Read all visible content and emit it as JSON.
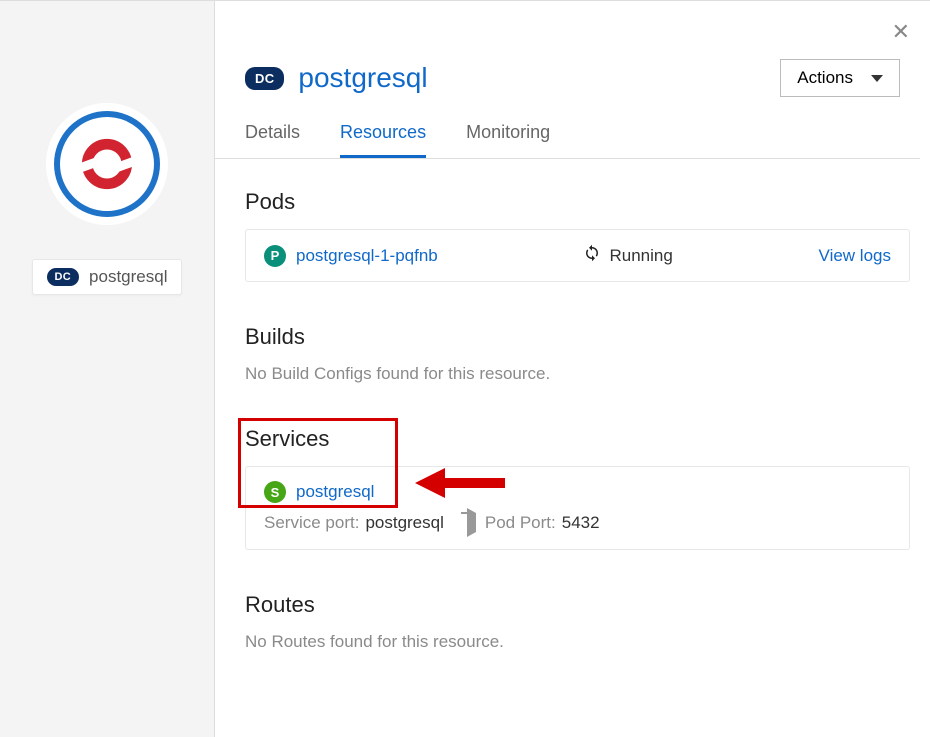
{
  "sidebar": {
    "badge": "DC",
    "label": "postgresql"
  },
  "header": {
    "badge": "DC",
    "title": "postgresql",
    "actions_label": "Actions"
  },
  "tabs": {
    "details": "Details",
    "resources": "Resources",
    "monitoring": "Monitoring"
  },
  "pods": {
    "heading": "Pods",
    "items": [
      {
        "badge": "P",
        "name": "postgresql-1-pqfnb",
        "status": "Running",
        "logs_label": "View logs"
      }
    ]
  },
  "builds": {
    "heading": "Builds",
    "empty_text": "No Build Configs found for this resource."
  },
  "services": {
    "heading": "Services",
    "items": [
      {
        "badge": "S",
        "name": "postgresql",
        "service_port_label": "Service port:",
        "service_port_value": "postgresql",
        "pod_port_label": "Pod Port:",
        "pod_port_value": "5432"
      }
    ]
  },
  "routes": {
    "heading": "Routes",
    "empty_text": "No Routes found for this resource."
  }
}
